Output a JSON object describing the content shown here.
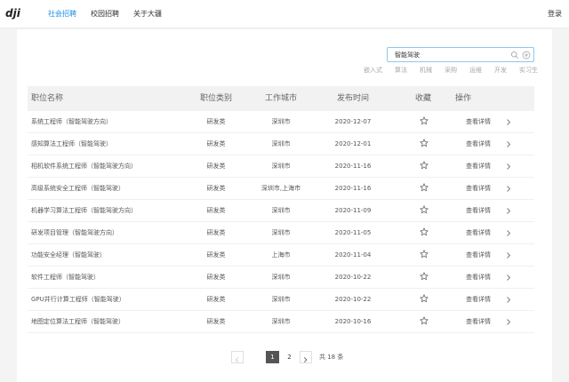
{
  "header": {
    "logo_text": "dji",
    "nav": [
      {
        "label": "社会招聘",
        "active": true
      },
      {
        "label": "校园招聘",
        "active": false
      },
      {
        "label": "关于大疆",
        "active": false
      }
    ],
    "login": "登录"
  },
  "search": {
    "value": "智能驾驶",
    "icon": "search-icon",
    "extra_icon": "plus-circle-icon"
  },
  "filters": [
    "嵌入式",
    "算法",
    "机械",
    "采购",
    "运维",
    "开发",
    "实习生"
  ],
  "table": {
    "columns": [
      "职位名称",
      "职位类别",
      "工作城市",
      "发布时间",
      "收藏",
      "操作"
    ],
    "rows": [
      {
        "name": "系统工程师（智能驾驶方向）",
        "category": "研发类",
        "city": "深圳市",
        "date": "2020-12-07",
        "action": "查看详情"
      },
      {
        "name": "感知算法工程师（智能驾驶）",
        "category": "研发类",
        "city": "深圳市",
        "date": "2020-12-01",
        "action": "查看详情"
      },
      {
        "name": "相机软件系统工程师（智能驾驶方向）",
        "category": "研发类",
        "city": "深圳市",
        "date": "2020-11-16",
        "action": "查看详情"
      },
      {
        "name": "高级系统安全工程师（智能驾驶）",
        "category": "研发类",
        "city": "深圳市,上海市",
        "date": "2020-11-16",
        "action": "查看详情"
      },
      {
        "name": "机器学习算法工程师（智能驾驶方向）",
        "category": "研发类",
        "city": "深圳市",
        "date": "2020-11-09",
        "action": "查看详情"
      },
      {
        "name": "研发项目管理（智能驾驶方向）",
        "category": "研发类",
        "city": "深圳市",
        "date": "2020-11-05",
        "action": "查看详情"
      },
      {
        "name": "功能安全经理（智能驾驶）",
        "category": "研发类",
        "city": "上海市",
        "date": "2020-11-04",
        "action": "查看详情"
      },
      {
        "name": "软件工程师（智能驾驶）",
        "category": "研发类",
        "city": "深圳市",
        "date": "2020-10-22",
        "action": "查看详情"
      },
      {
        "name": "GPU并行计算工程师（智能驾驶）",
        "category": "研发类",
        "city": "深圳市",
        "date": "2020-10-22",
        "action": "查看详情"
      },
      {
        "name": "地图定位算法工程师（智能驾驶）",
        "category": "研发类",
        "city": "深圳市",
        "date": "2020-10-16",
        "action": "查看详情"
      }
    ]
  },
  "pagination": {
    "pages": [
      "1",
      "2"
    ],
    "current": "1",
    "total": "共 18 条"
  },
  "colors": {
    "accent": "#1f8fe6",
    "active_page": "#555555",
    "header_row": "#f2f2f2"
  }
}
